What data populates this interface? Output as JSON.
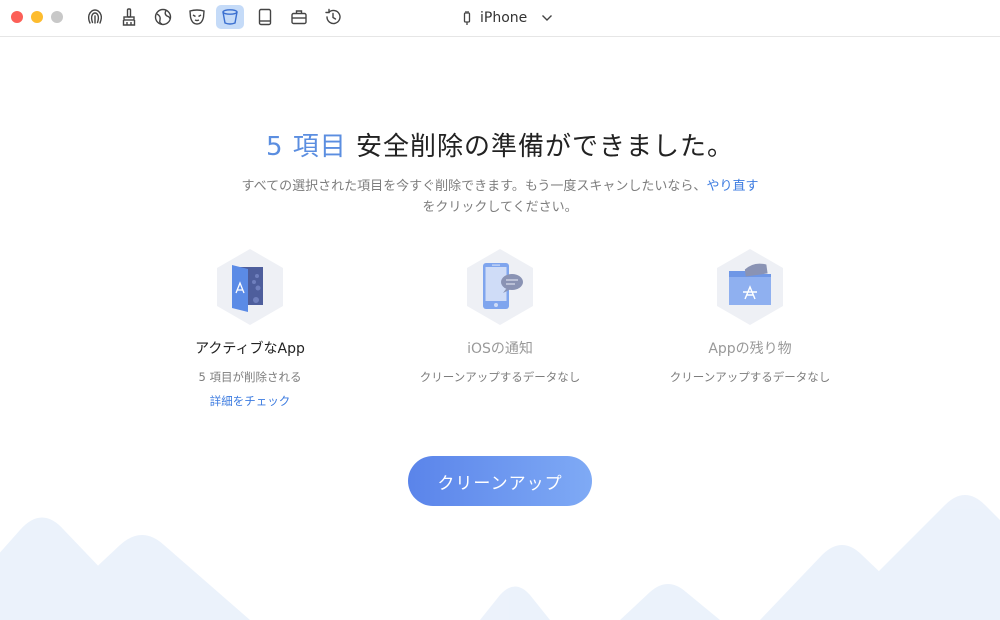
{
  "toolbar": {
    "icons": [
      "fingerprint-icon",
      "brush-icon",
      "globe-icon",
      "mask-icon",
      "bucket-icon",
      "tablet-icon",
      "toolbox-icon",
      "history-icon"
    ],
    "active_index": 4
  },
  "device": {
    "name": "iPhone"
  },
  "headline": {
    "count": "5 項目",
    "text": " 安全削除の準備ができました。"
  },
  "subtitle": {
    "line1_prefix": "すべての選択された項目を今すぐ削除できます。もう一度スキャンしたいなら、",
    "redo_link": "やり直す",
    "line2": "をクリックしてください。"
  },
  "cards": [
    {
      "name": "アクティブなApp",
      "desc": "5 項目が削除される",
      "check": "詳細をチェック"
    },
    {
      "name": "iOSの通知",
      "desc": "クリーンアップするデータなし"
    },
    {
      "name": "Appの残り物",
      "desc": "クリーンアップするデータなし"
    }
  ],
  "action": {
    "clean_label": "クリーンアップ"
  },
  "colors": {
    "accent": "#5b8ee0",
    "link": "#3c7be0",
    "button_start": "#5a84ea",
    "button_end": "#7faaf5"
  }
}
